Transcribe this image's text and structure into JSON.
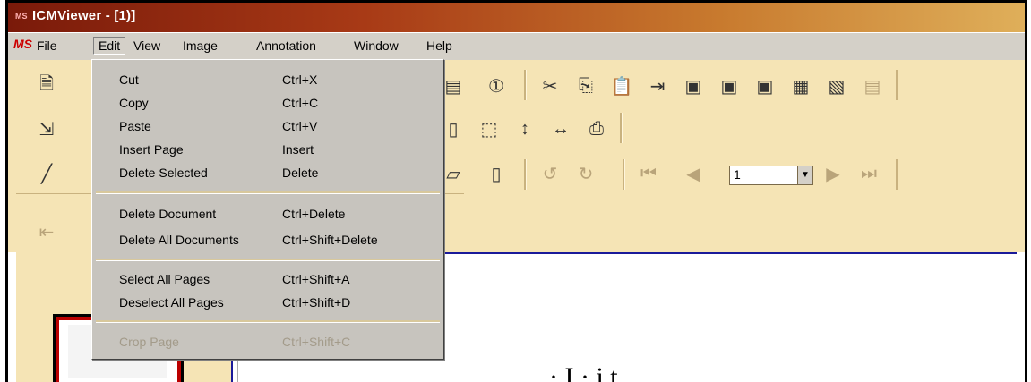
{
  "window": {
    "title": "ICMViewer - [1)]",
    "app_logo": "MS"
  },
  "menubar": {
    "items": [
      {
        "label": "File"
      },
      {
        "label": "Edit"
      },
      {
        "label": "View"
      },
      {
        "label": "Image"
      },
      {
        "label": "Annotation"
      },
      {
        "label": "Window"
      },
      {
        "label": "Help"
      }
    ],
    "open_menu": "Edit"
  },
  "edit_menu": {
    "items": [
      {
        "label": "Cut",
        "shortcut": "Ctrl+X",
        "enabled": true
      },
      {
        "label": "Copy",
        "shortcut": "Ctrl+C",
        "enabled": true
      },
      {
        "label": "Paste",
        "shortcut": "Ctrl+V",
        "enabled": true
      },
      {
        "label": "Insert Page",
        "shortcut": "Insert",
        "enabled": true
      },
      {
        "label": "Delete Selected",
        "shortcut": "Delete",
        "enabled": true
      },
      {
        "label": "Delete Document",
        "shortcut": "Ctrl+Delete",
        "enabled": true
      },
      {
        "label": "Delete All Documents",
        "shortcut": "Ctrl+Shift+Delete",
        "enabled": true
      },
      {
        "label": "Select All Pages",
        "shortcut": "Ctrl+Shift+A",
        "enabled": true
      },
      {
        "label": "Deselect All Pages",
        "shortcut": "Ctrl+Shift+D",
        "enabled": true
      },
      {
        "label": "Crop Page",
        "shortcut": "Ctrl+Shift+C",
        "enabled": false
      }
    ]
  },
  "navigation": {
    "page_value": "1"
  },
  "document": {
    "visible_text": "· I · i t"
  },
  "colors": {
    "toolbar_bg": "#f5e4b5",
    "menu_bg": "#c7c4be",
    "title_start": "#7a1a0a",
    "title_end": "#dfaf5a",
    "accent_blue": "#1a1a9a",
    "disabled_text": "#a39b8a"
  }
}
